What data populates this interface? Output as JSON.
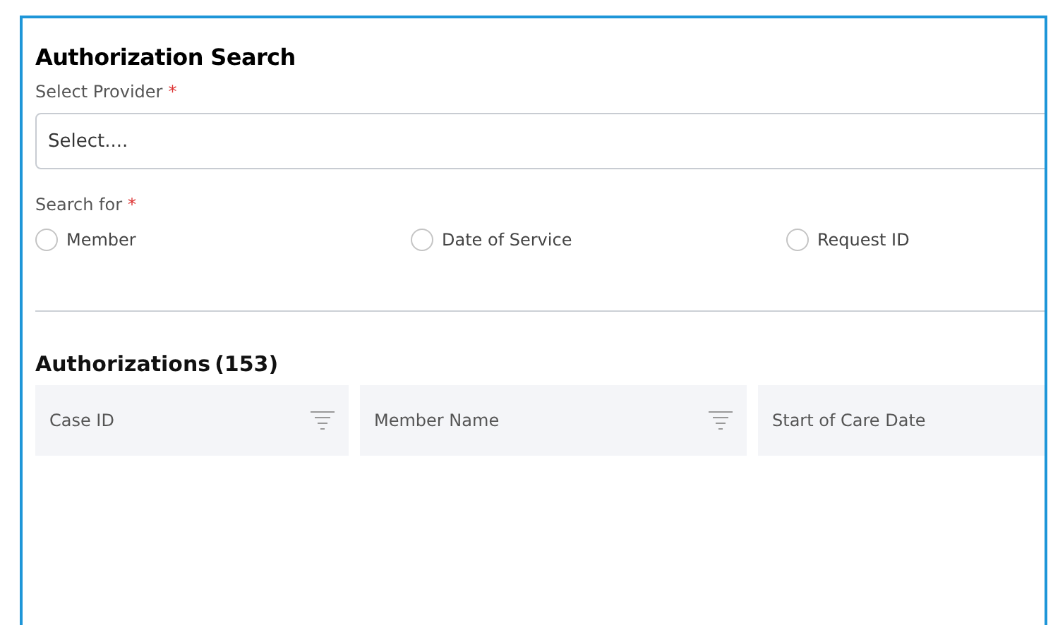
{
  "title": "Authorization Search",
  "provider": {
    "label": "Select Provider",
    "required_mark": "*",
    "placeholder": "Select...."
  },
  "search_for": {
    "label": "Search for",
    "required_mark": "*",
    "options": [
      {
        "label": "Member",
        "selected": false
      },
      {
        "label": "Date of Service",
        "selected": false
      },
      {
        "label": "Request ID",
        "selected": false
      }
    ]
  },
  "results": {
    "title": "Authorizations",
    "count": "(153)"
  },
  "table": {
    "columns": [
      {
        "label": "Case ID",
        "filter": true
      },
      {
        "label": "Member Name",
        "filter": true
      },
      {
        "label": "Start of Care Date",
        "filter": false
      }
    ]
  }
}
